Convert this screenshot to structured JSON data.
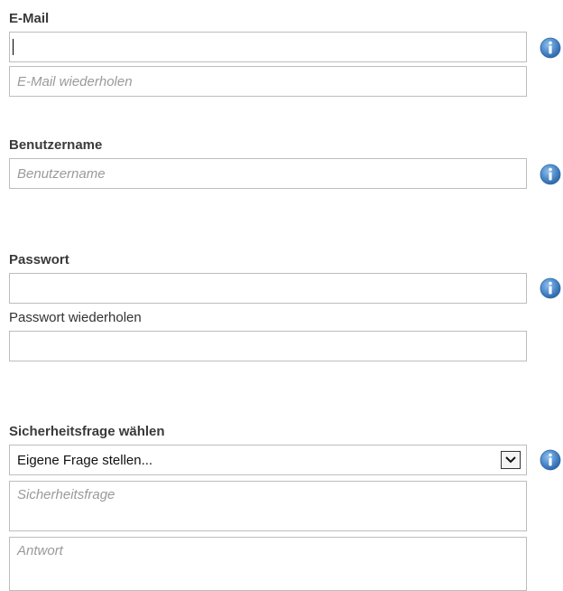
{
  "email": {
    "label": "E-Mail",
    "value": "",
    "repeat_placeholder": "E-Mail wiederholen"
  },
  "username": {
    "label": "Benutzername",
    "placeholder": "Benutzername"
  },
  "password": {
    "label": "Passwort",
    "repeat_label": "Passwort wiederholen"
  },
  "security": {
    "label": "Sicherheitsfrage wählen",
    "selected": "Eigene Frage stellen...",
    "question_placeholder": "Sicherheitsfrage",
    "answer_placeholder": "Antwort"
  },
  "icons": {
    "info": "info-icon",
    "dropdown": "chevron-down-icon"
  },
  "colors": {
    "info_blue": "#3f79b8",
    "border": "#bdbdbd",
    "placeholder": "#9a9a9a"
  }
}
